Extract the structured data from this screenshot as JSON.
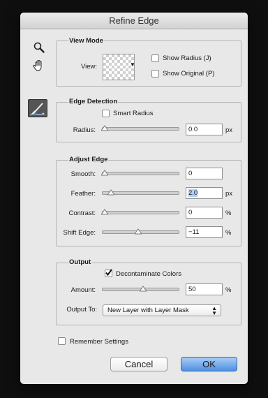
{
  "dialog": {
    "title": "Refine Edge"
  },
  "tools": {
    "zoom_icon": "magnifier-icon",
    "hand_icon": "hand-icon",
    "brush_icon": "refine-radius-brush-icon"
  },
  "view_mode": {
    "title": "View Mode",
    "view_label": "View:",
    "show_radius": {
      "label": "Show Radius (J)",
      "checked": false
    },
    "show_original": {
      "label": "Show Original (P)",
      "checked": false
    }
  },
  "edge_detection": {
    "title": "Edge Detection",
    "smart_radius": {
      "label": "Smart Radius",
      "checked": false
    },
    "radius": {
      "label": "Radius:",
      "value": "0.0",
      "unit": "px",
      "level": 0.0
    }
  },
  "adjust_edge": {
    "title": "Adjust Edge",
    "smooth": {
      "label": "Smooth:",
      "value": "0",
      "unit": "",
      "level": 0.0
    },
    "feather": {
      "label": "Feather:",
      "value": "2.0",
      "unit": "px",
      "level": 0.08
    },
    "contrast": {
      "label": "Contrast:",
      "value": "0",
      "unit": "%",
      "level": 0.0
    },
    "shift_edge": {
      "label": "Shift Edge:",
      "value": "−11",
      "unit": "%",
      "level": 0.44
    }
  },
  "output": {
    "title": "Output",
    "decontaminate": {
      "label": "Decontaminate Colors",
      "checked": true
    },
    "amount": {
      "label": "Amount:",
      "value": "50",
      "unit": "%",
      "level": 0.5
    },
    "output_to": {
      "label": "Output To:",
      "selected": "New Layer with Layer Mask"
    }
  },
  "remember": {
    "label": "Remember Settings",
    "checked": false
  },
  "buttons": {
    "cancel": "Cancel",
    "ok": "OK"
  },
  "colors": {
    "ok_button": "#4f90df",
    "dialog_bg": "#e8e8e8"
  }
}
